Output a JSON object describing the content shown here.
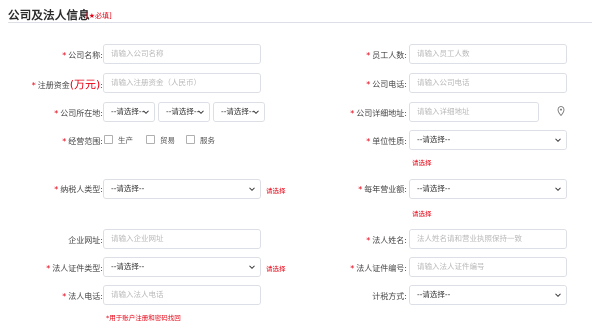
{
  "header": {
    "title": "公司及法人信息",
    "required_note": "[★必填]"
  },
  "fields": {
    "company_name": {
      "star": "*",
      "label": "公司名称:",
      "placeholder": "请输入公司名称"
    },
    "employee_count": {
      "star": "*",
      "label": "员工人数:",
      "placeholder": "请输入员工人数"
    },
    "registered_capital": {
      "star": "*",
      "label": "注册资金",
      "label_unit": "(万元)",
      "label_colon": ":",
      "placeholder": "请输入注册资金（人民币）"
    },
    "company_phone": {
      "star": "*",
      "label": "公司电话:",
      "placeholder": "请输入公司电话"
    },
    "company_location": {
      "star": "*",
      "label": "公司所在地:",
      "select_1": "--请选择--",
      "select_2": "--请选择--",
      "select_3": "--请选择--"
    },
    "company_address": {
      "star": "*",
      "label": "公司详细地址:",
      "placeholder": "请输入详细地址"
    },
    "business_scope": {
      "star": "*",
      "label": "经营范围:",
      "options": [
        "生产",
        "贸易",
        "服务"
      ]
    },
    "unit_nature": {
      "star": "*",
      "label": "单位性质:",
      "value": "--请选择--",
      "hint": "请选择"
    },
    "taxpayer_type": {
      "star": "*",
      "label": "纳税人类型:",
      "value": "--请选择--",
      "hint": "请选择"
    },
    "annual_revenue": {
      "star": "*",
      "label": "每年营业额:",
      "value": "--请选择--",
      "hint": "请选择"
    },
    "company_website": {
      "label": "企业网址:",
      "placeholder": "请输入企业网址"
    },
    "legal_name": {
      "star": "*",
      "label": "法人姓名:",
      "placeholder": "法人姓名请和营业执照保持一致"
    },
    "legal_id_type": {
      "star": "*",
      "label": "法人证件类型:",
      "value": "--请选择--",
      "hint": "请选择"
    },
    "legal_id_number": {
      "star": "*",
      "label": "法人证件编号:",
      "placeholder": "请输入法人证件编号"
    },
    "legal_phone": {
      "star": "*",
      "label": "法人电话:",
      "placeholder": "请输入法人电话",
      "hint": "*用于账户注册和密码找回"
    },
    "tax_method": {
      "label": "计税方式:",
      "value": "--请选择--"
    }
  },
  "colors": {
    "required": "#e60012",
    "border": "#dcdfe6",
    "placeholder": "#b8b8b8"
  },
  "icons": {
    "chevron": "chevron-down-icon",
    "location": "map-pin-icon"
  }
}
